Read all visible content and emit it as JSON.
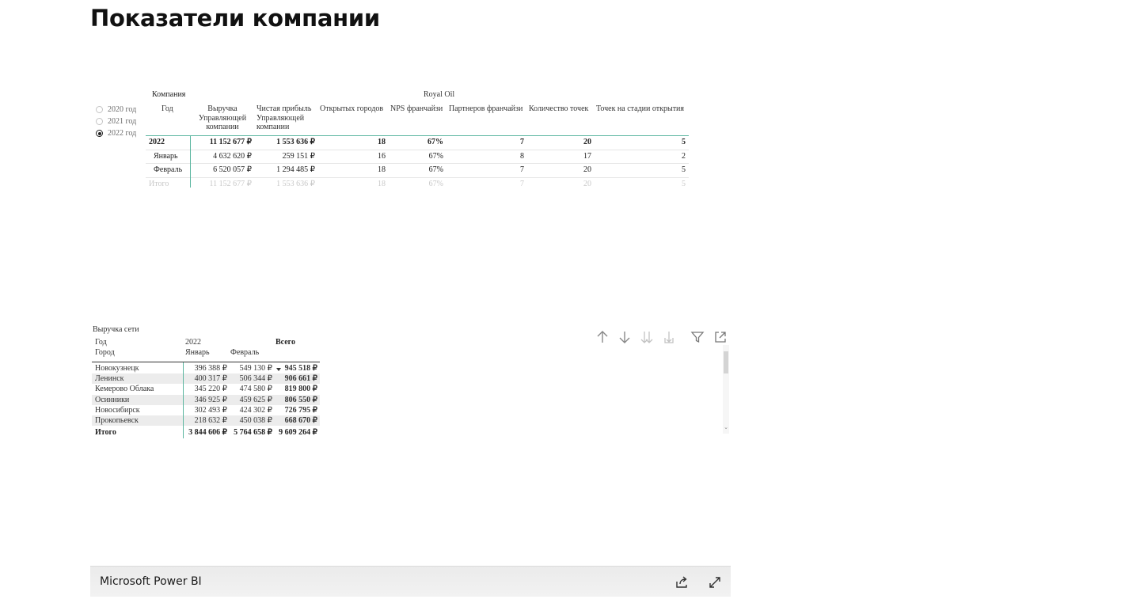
{
  "page": {
    "title": "Показатели компании"
  },
  "slicer": {
    "options": [
      {
        "label": "2020 год",
        "selected": false
      },
      {
        "label": "2021 год",
        "selected": false
      },
      {
        "label": "2022 год",
        "selected": true
      }
    ]
  },
  "matrix_company": {
    "company_label": "Компания",
    "company_name": "Royal Oil",
    "headers": {
      "year": "Год",
      "revenue": [
        "Выручка",
        "Управляющей",
        "компании"
      ],
      "profit": [
        "Чистая прибыль",
        "Управляющей",
        "компании"
      ],
      "cities": "Открытых городов",
      "nps": "NPS франчайзи",
      "partners": "Партнеров франчайзи",
      "points": "Количество точек",
      "opening": "Точек на стадии открытия"
    },
    "rows": [
      {
        "label": "2022",
        "revenue": "11 152 677 ₽",
        "profit": "1 553 636 ₽",
        "cities": "18",
        "nps": "67%",
        "partners": "7",
        "points": "20",
        "opening": "5"
      },
      {
        "label": "Январь",
        "revenue": "4 632 620 ₽",
        "profit": "259 151 ₽",
        "cities": "16",
        "nps": "67%",
        "partners": "8",
        "points": "17",
        "opening": "2"
      },
      {
        "label": "Февраль",
        "revenue": "6 520 057 ₽",
        "profit": "1 294 485 ₽",
        "cities": "18",
        "nps": "67%",
        "partners": "7",
        "points": "20",
        "opening": "5"
      },
      {
        "label": "Итого",
        "revenue": "11 152 677 ₽",
        "profit": "1 553 636 ₽",
        "cities": "18",
        "nps": "67%",
        "partners": "7",
        "points": "20",
        "opening": "5"
      }
    ]
  },
  "matrix_network": {
    "title": "Выручка сети",
    "row_header_year": "Год",
    "row_header_city": "Город",
    "year": "2022",
    "months": [
      "Январь",
      "Февраль"
    ],
    "total_header": "Всего",
    "rows": [
      {
        "city": "Новокузнецк",
        "jan": "396 388 ₽",
        "feb": "549 130 ₽",
        "total": "945 518 ₽"
      },
      {
        "city": "Ленинск",
        "jan": "400 317 ₽",
        "feb": "506 344 ₽",
        "total": "906 661 ₽"
      },
      {
        "city": "Кемерово Облака",
        "jan": "345 220 ₽",
        "feb": "474 580 ₽",
        "total": "819 800 ₽"
      },
      {
        "city": "Осинники",
        "jan": "346 925 ₽",
        "feb": "459 625 ₽",
        "total": "806 550 ₽"
      },
      {
        "city": "Новосибирск",
        "jan": "302 493 ₽",
        "feb": "424 302 ₽",
        "total": "726 795 ₽"
      },
      {
        "city": "Прокопьевск",
        "jan": "218 632 ₽",
        "feb": "450 038 ₽",
        "total": "668 670 ₽"
      }
    ],
    "totals": {
      "label": "Итого",
      "jan": "3 844 606 ₽",
      "feb": "5 764 658 ₽",
      "total": "9 609 264 ₽"
    }
  },
  "visual_header": {
    "icons": [
      "drill-up-icon",
      "drill-down-icon",
      "expand-next-level-icon",
      "expand-hierarchy-icon",
      "filter-icon",
      "focus-mode-icon"
    ]
  },
  "footer": {
    "brand": "Microsoft Power BI",
    "icons": [
      "share-icon",
      "fullscreen-icon"
    ]
  },
  "colors": {
    "accent": "#5cb6a0",
    "shaded_row": "#ececec",
    "footer_bg": "#ebebeb"
  }
}
